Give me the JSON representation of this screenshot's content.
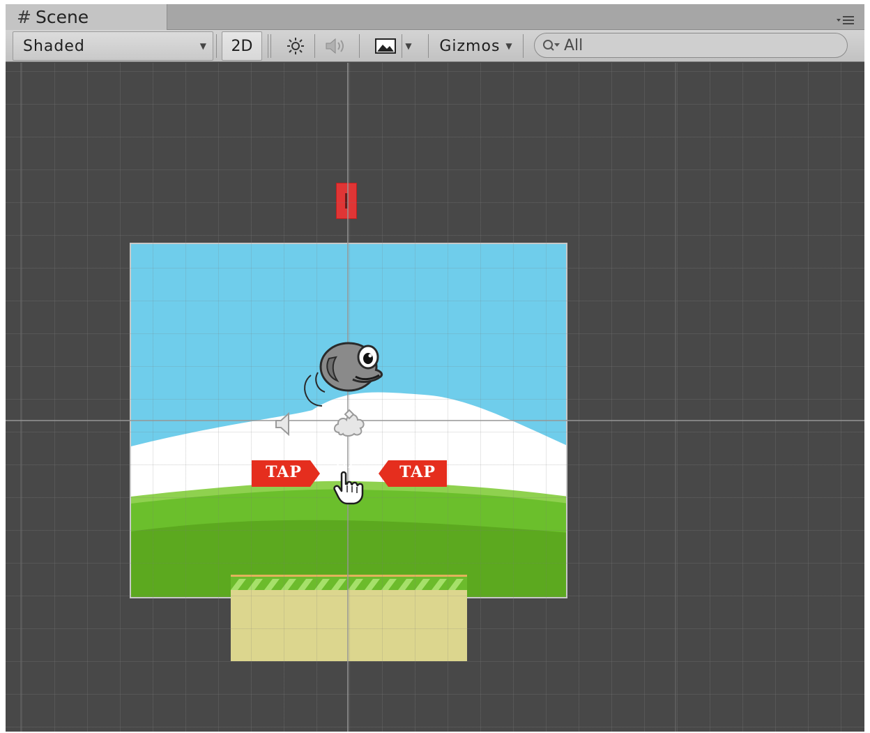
{
  "tab": {
    "icon": "hash-icon",
    "title": "Scene"
  },
  "toolbar": {
    "shading_mode": "Shaded",
    "mode_2d_label": "2D",
    "light_icon": "sun-icon",
    "audio_icon": "speaker-icon",
    "effects_icon": "image-icon",
    "gizmos_label": "Gizmos",
    "search": {
      "value": "All",
      "placeholder": "All"
    }
  },
  "scene": {
    "tap_left_label": "TAP",
    "tap_right_label": "TAP",
    "colors": {
      "sky": "#6fcdeb",
      "hill_white": "#ffffff",
      "grass": "#5fae22",
      "sand": "#dcd68e",
      "marker": "#e03535",
      "tap_badge": "#e52e1e",
      "viewport_bg": "#484848"
    }
  }
}
